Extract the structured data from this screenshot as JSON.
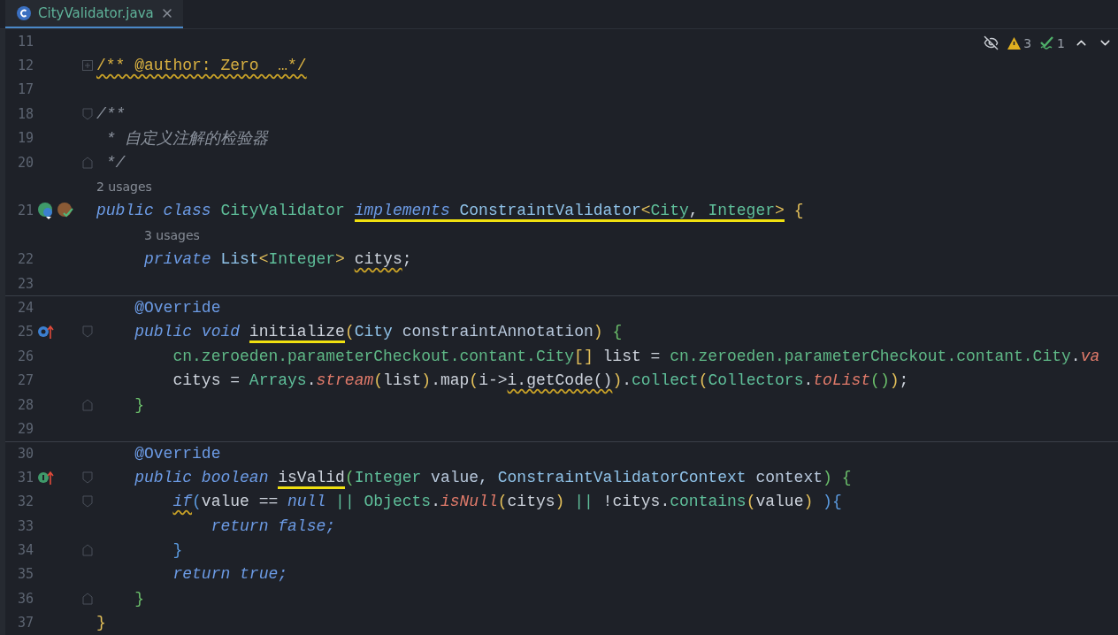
{
  "tab": {
    "title": "CityValidator.java",
    "selected": true
  },
  "inspections": {
    "warnings": "3",
    "weak_warnings": "1"
  },
  "lines": [
    {
      "number": "11"
    },
    {
      "number": "12",
      "folded": true,
      "tokens": [
        {
          "text": "/** @author: Zero  …*/",
          "kind": "folded",
          "warning": true
        }
      ]
    },
    {
      "number": "17"
    },
    {
      "number": "18",
      "fold_start": true,
      "tokens": [
        {
          "text": "/**",
          "kind": "comment"
        }
      ]
    },
    {
      "number": "19",
      "tokens": [
        {
          "text": " * 自定义注解的检验器",
          "kind": "comment"
        }
      ]
    },
    {
      "number": "20",
      "fold_end": true,
      "tokens": [
        {
          "text": " */",
          "kind": "comment"
        }
      ]
    },
    {
      "number": "21",
      "hint": "2 usages",
      "gutter": [
        {
          "kind": "class"
        },
        {
          "kind": "plugin"
        }
      ],
      "tokens": [
        {
          "text": "public class ",
          "kind": "keyword"
        },
        {
          "text": "CityValidator ",
          "kind": "class"
        },
        {
          "text": "implements ",
          "kind": "keyword",
          "highlighted": true
        },
        {
          "text": "ConstraintValidator",
          "kind": "interface",
          "highlighted": true
        },
        {
          "text": "<",
          "kind": "bracket-yellow",
          "highlighted": true
        },
        {
          "text": "City",
          "kind": "class",
          "highlighted": true
        },
        {
          "text": ", ",
          "kind": "plain",
          "highlighted": true
        },
        {
          "text": "Integer",
          "kind": "class",
          "highlighted": true
        },
        {
          "text": ">",
          "kind": "bracket-yellow",
          "highlighted": true
        },
        {
          "text": " {",
          "kind": "bracket-yellow"
        }
      ]
    },
    {
      "number": "22",
      "hint": "3 usages",
      "tokens": [
        {
          "text": "     private ",
          "kind": "keyword"
        },
        {
          "text": "List",
          "kind": "interface"
        },
        {
          "text": "<",
          "kind": "bracket-yellow"
        },
        {
          "text": "Integer",
          "kind": "class"
        },
        {
          "text": "> ",
          "kind": "bracket-yellow"
        },
        {
          "text": "citys",
          "kind": "plain",
          "warning": true
        },
        {
          "text": ";",
          "kind": "plain"
        }
      ]
    },
    {
      "number": "23"
    },
    {
      "number": "24",
      "separator": true,
      "tokens": [
        {
          "text": "    @Override",
          "kind": "annotation"
        }
      ]
    },
    {
      "number": "25",
      "fold_start": true,
      "gutter": [
        {
          "kind": "method"
        }
      ],
      "tokens": [
        {
          "text": "    public void ",
          "kind": "keyword"
        },
        {
          "text": "initialize",
          "kind": "plain",
          "highlighted": true
        },
        {
          "text": "(",
          "kind": "bracket-yellow"
        },
        {
          "text": "City ",
          "kind": "interface"
        },
        {
          "text": "constraintAnnotation",
          "kind": "param"
        },
        {
          "text": ")",
          "kind": "bracket-yellow"
        },
        {
          "text": " {",
          "kind": "bracket-green"
        }
      ]
    },
    {
      "number": "26",
      "tokens": [
        {
          "text": "        cn.zeroeden.parameterCheckout.contant.City",
          "kind": "package"
        },
        {
          "text": "[]",
          "kind": "bracket-yellow"
        },
        {
          "text": " list = ",
          "kind": "plain"
        },
        {
          "text": "cn.zeroeden.parameterCheckout.contant.City",
          "kind": "package"
        },
        {
          "text": ".",
          "kind": "plain"
        },
        {
          "text": "va",
          "kind": "static"
        }
      ]
    },
    {
      "number": "27",
      "tokens": [
        {
          "text": "        citys = ",
          "kind": "plain"
        },
        {
          "text": "Arrays",
          "kind": "class"
        },
        {
          "text": ".",
          "kind": "plain"
        },
        {
          "text": "stream",
          "kind": "static"
        },
        {
          "text": "(",
          "kind": "bracket-yellow"
        },
        {
          "text": "list",
          "kind": "plain"
        },
        {
          "text": ")",
          "kind": "bracket-yellow"
        },
        {
          "text": ".map",
          "kind": "plain"
        },
        {
          "text": "(",
          "kind": "bracket-yellow"
        },
        {
          "text": "i->",
          "kind": "plain"
        },
        {
          "text": "i.getCode()",
          "kind": "plain",
          "warning": true
        },
        {
          "text": ")",
          "kind": "bracket-yellow"
        },
        {
          "text": ".",
          "kind": "plain"
        },
        {
          "text": "collect",
          "kind": "method"
        },
        {
          "text": "(",
          "kind": "bracket-yellow"
        },
        {
          "text": "Collectors",
          "kind": "class"
        },
        {
          "text": ".",
          "kind": "plain"
        },
        {
          "text": "toList",
          "kind": "static"
        },
        {
          "text": "()",
          "kind": "bracket-green"
        },
        {
          "text": ")",
          "kind": "bracket-yellow"
        },
        {
          "text": ";",
          "kind": "plain"
        }
      ]
    },
    {
      "number": "28",
      "fold_end": true,
      "tokens": [
        {
          "text": "    }",
          "kind": "bracket-green"
        }
      ]
    },
    {
      "number": "29"
    },
    {
      "number": "30",
      "separator": true,
      "tokens": [
        {
          "text": "    @Override",
          "kind": "annotation"
        }
      ]
    },
    {
      "number": "31",
      "fold_start": true,
      "gutter": [
        {
          "kind": "interface-method"
        }
      ],
      "tokens": [
        {
          "text": "    public boolean ",
          "kind": "keyword"
        },
        {
          "text": "isValid",
          "kind": "plain",
          "highlighted": true
        },
        {
          "text": "(",
          "kind": "bracket-green"
        },
        {
          "text": "Integer ",
          "kind": "class"
        },
        {
          "text": "value, ",
          "kind": "param"
        },
        {
          "text": "ConstraintValidatorContext ",
          "kind": "interface"
        },
        {
          "text": "context",
          "kind": "param"
        },
        {
          "text": ")",
          "kind": "bracket-green"
        },
        {
          "text": " {",
          "kind": "bracket-green"
        }
      ]
    },
    {
      "number": "32",
      "fold_start": true,
      "tokens": [
        {
          "text": "        if",
          "kind": "keyword",
          "warning": true
        },
        {
          "text": "(",
          "kind": "bracket-blue"
        },
        {
          "text": "value == ",
          "kind": "plain"
        },
        {
          "text": "null",
          "kind": "keyword"
        },
        {
          "text": " || ",
          "kind": "method"
        },
        {
          "text": "Objects",
          "kind": "class"
        },
        {
          "text": ".",
          "kind": "plain"
        },
        {
          "text": "isNull",
          "kind": "static"
        },
        {
          "text": "(",
          "kind": "bracket-yellow"
        },
        {
          "text": "citys",
          "kind": "plain"
        },
        {
          "text": ")",
          "kind": "bracket-yellow"
        },
        {
          "text": " || ",
          "kind": "method"
        },
        {
          "text": "!citys.",
          "kind": "plain"
        },
        {
          "text": "contains",
          "kind": "method"
        },
        {
          "text": "(",
          "kind": "bracket-yellow"
        },
        {
          "text": "value",
          "kind": "plain"
        },
        {
          "text": ") ",
          "kind": "bracket-yellow"
        },
        {
          "text": ")",
          "kind": "bracket-blue"
        },
        {
          "text": "{",
          "kind": "bracket-blue"
        }
      ]
    },
    {
      "number": "33",
      "tokens": [
        {
          "text": "            return false",
          "kind": "keyword"
        },
        {
          "text": ";",
          "kind": "keyword"
        }
      ]
    },
    {
      "number": "34",
      "fold_end": true,
      "tokens": [
        {
          "text": "        }",
          "kind": "bracket-blue"
        }
      ]
    },
    {
      "number": "35",
      "tokens": [
        {
          "text": "        return true",
          "kind": "keyword"
        },
        {
          "text": ";",
          "kind": "keyword"
        }
      ]
    },
    {
      "number": "36",
      "fold_end": true,
      "tokens": [
        {
          "text": "    }",
          "kind": "bracket-green"
        }
      ]
    },
    {
      "number": "37",
      "tokens": [
        {
          "text": "}",
          "kind": "bracket-yellow"
        }
      ]
    }
  ]
}
